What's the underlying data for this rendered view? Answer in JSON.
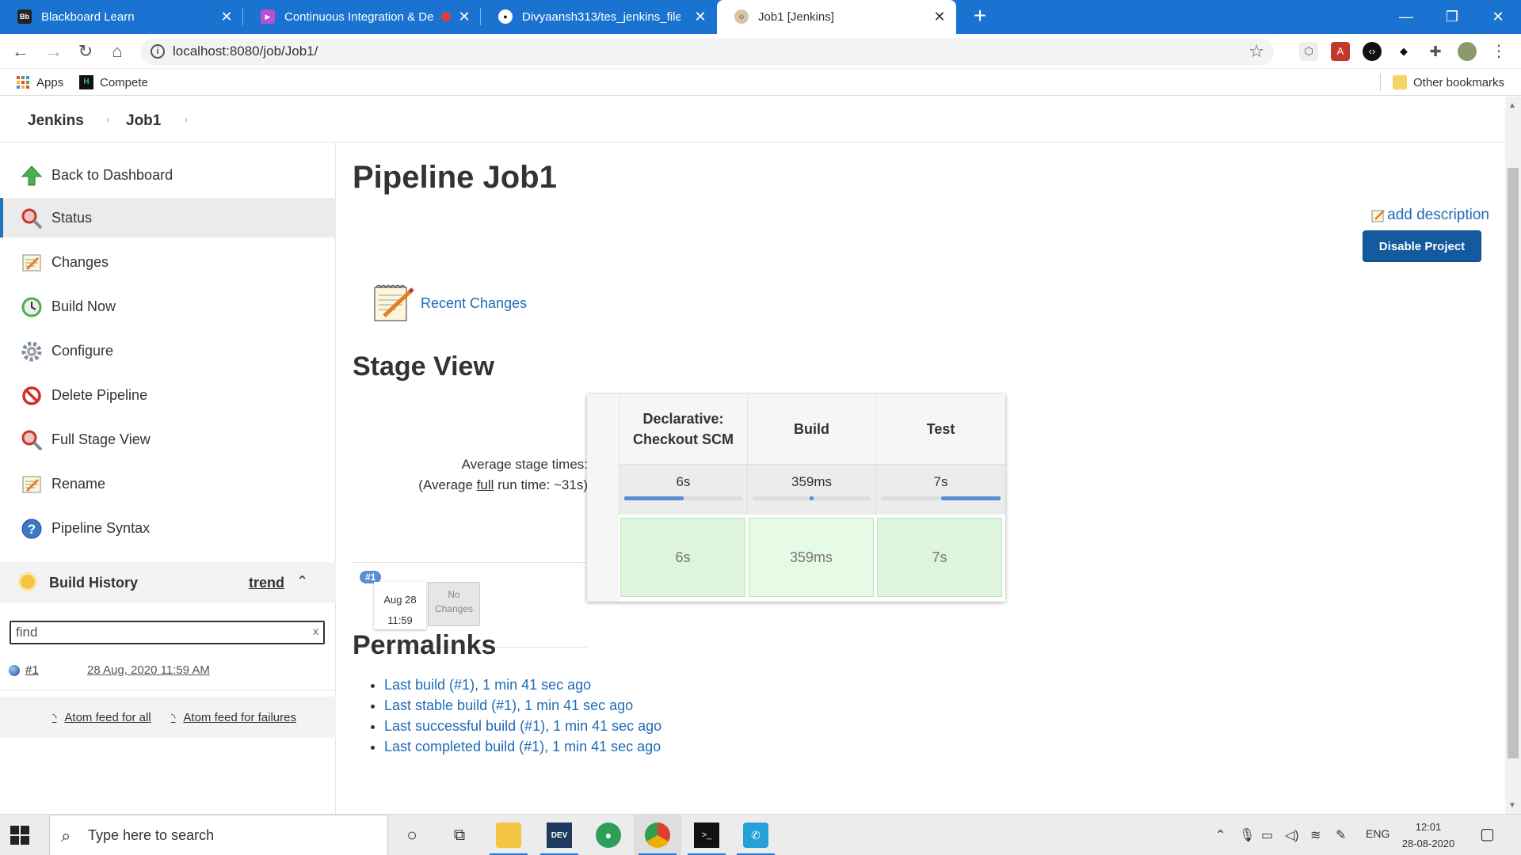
{
  "browser": {
    "tabs": [
      {
        "title": "Blackboard Learn",
        "icon": "blackboard-icon",
        "active": false
      },
      {
        "title": "Continuous Integration & De",
        "icon": "presentation-icon",
        "active": false
      },
      {
        "title": "Divyaansh313/tes_jenkins_file",
        "icon": "github-icon",
        "active": false
      },
      {
        "title": "Job1 [Jenkins]",
        "icon": "jenkins-icon",
        "active": true
      }
    ],
    "url": "localhost:8080/job/Job1/",
    "bookmarks": [
      {
        "label": "Apps",
        "icon": "apps-grid-icon"
      },
      {
        "label": "Compete",
        "icon": "hackerrank-icon"
      }
    ],
    "other_bookmarks": "Other bookmarks"
  },
  "breadcrumbs": [
    "Jenkins",
    "Job1"
  ],
  "sidebar": {
    "tasks": [
      {
        "label": "Back to Dashboard",
        "icon": "up-arrow-icon"
      },
      {
        "label": "Status",
        "icon": "magnifier-icon",
        "active": true
      },
      {
        "label": "Changes",
        "icon": "notepad-icon"
      },
      {
        "label": "Build Now",
        "icon": "clock-build-icon"
      },
      {
        "label": "Configure",
        "icon": "gear-icon"
      },
      {
        "label": "Delete Pipeline",
        "icon": "no-entry-icon"
      },
      {
        "label": "Full Stage View",
        "icon": "magnifier-icon"
      },
      {
        "label": "Rename",
        "icon": "notepad-icon"
      },
      {
        "label": "Pipeline Syntax",
        "icon": "help-icon"
      }
    ],
    "build_history": {
      "title": "Build History",
      "trend": "trend",
      "search_placeholder": "find",
      "search_clear": "x",
      "builds": [
        {
          "number": "#1",
          "date": "28 Aug, 2020 11:59 AM"
        }
      ],
      "feed_all": "Atom feed for all",
      "feed_failures": "Atom feed for failures"
    }
  },
  "main": {
    "title": "Pipeline Job1",
    "add_description": "add description",
    "disable_button": "Disable Project",
    "recent_changes": "Recent Changes",
    "stage_view_heading": "Stage View",
    "avg_stage_times": "Average stage times:",
    "avg_full_prefix": "(Average ",
    "avg_full_link": "full",
    "avg_full_suffix": " run time: ~31s)",
    "build": {
      "number": "#1",
      "month_day": "Aug 28",
      "time": "11:59",
      "changes_line1": "No",
      "changes_line2": "Changes"
    },
    "stages": [
      {
        "name_line1": "Declarative:",
        "name_line2": "Checkout SCM",
        "avg": "6s",
        "cell": "6s",
        "bar_fill": 0.5
      },
      {
        "name_line1": "Build",
        "name_line2": "",
        "avg": "359ms",
        "cell": "359ms",
        "bar_fill": 0.03
      },
      {
        "name_line1": "Test",
        "name_line2": "",
        "avg": "7s",
        "cell": "7s",
        "bar_fill": 0.5
      }
    ],
    "permalinks_heading": "Permalinks",
    "permalinks": [
      "Last build (#1), 1 min 41 sec ago",
      "Last stable build (#1), 1 min 41 sec ago",
      "Last successful build (#1), 1 min 41 sec ago",
      "Last completed build (#1), 1 min 41 sec ago"
    ]
  },
  "taskbar": {
    "search_placeholder": "Type here to search",
    "language": "ENG",
    "time": "12:01",
    "date": "28-08-2020"
  },
  "colors": {
    "tabbar": "#1a73d0",
    "link": "#1f6bb7",
    "button": "#135b9e",
    "stage_success": "#dcf5dc"
  }
}
